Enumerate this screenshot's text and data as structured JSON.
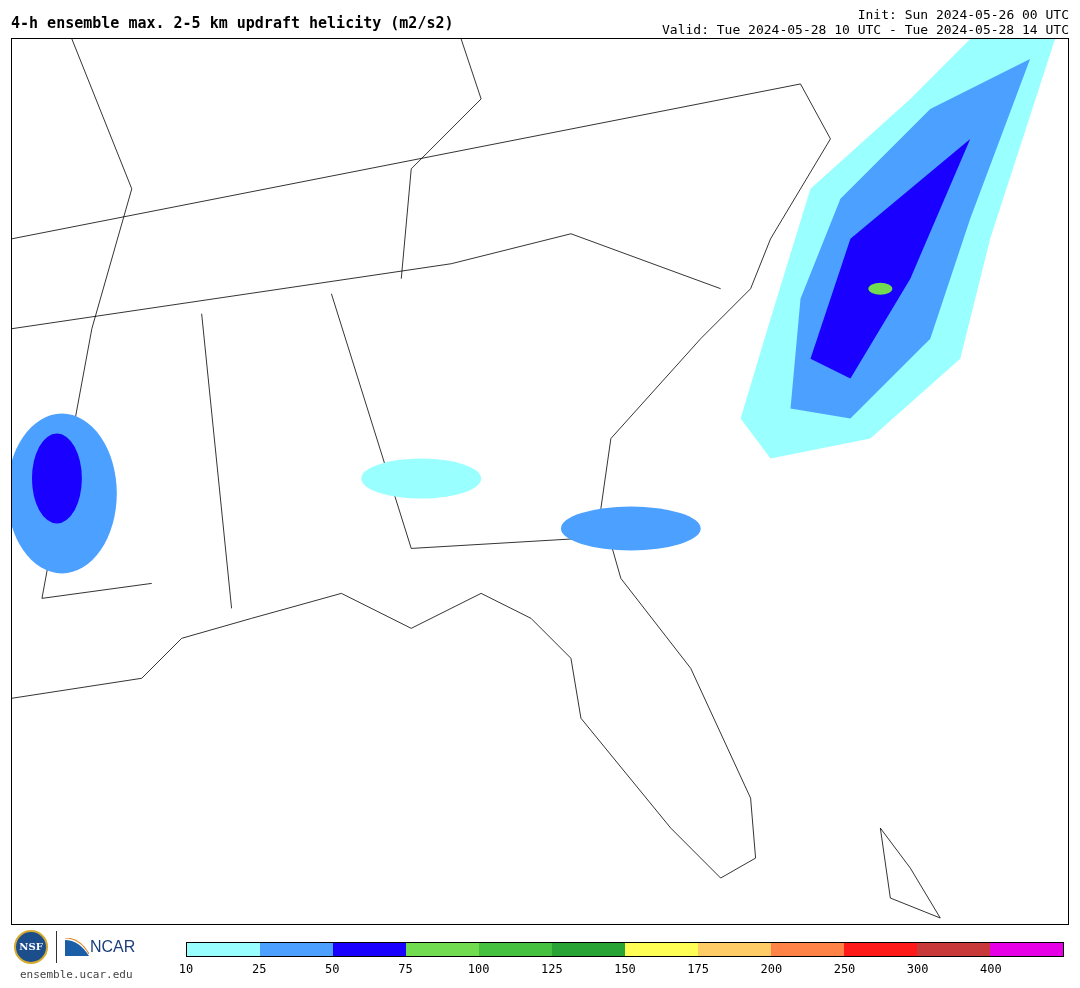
{
  "title": "4-h ensemble max. 2-5 km updraft helicity (m2/s2)",
  "init": "Init: Sun 2024-05-26 00 UTC",
  "valid": "Valid: Tue 2024-05-28 10 UTC - Tue 2024-05-28 14 UTC",
  "logos": {
    "nsf": "NSF",
    "ncar": "NCAR",
    "url": "ensemble.ucar.edu"
  },
  "colorbar": {
    "bins": [
      {
        "color": "#99ffff"
      },
      {
        "color": "#4ca0ff"
      },
      {
        "color": "#1a00ff"
      },
      {
        "color": "#72dc50"
      },
      {
        "color": "#45c13f"
      },
      {
        "color": "#27a435"
      },
      {
        "color": "#ffff55"
      },
      {
        "color": "#ffcc66"
      },
      {
        "color": "#ff8247"
      },
      {
        "color": "#ff1a1a"
      },
      {
        "color": "#c83a3a"
      },
      {
        "color": "#e600e6"
      }
    ],
    "ticks": [
      "10",
      "25",
      "50",
      "75",
      "100",
      "125",
      "150",
      "175",
      "200",
      "250",
      "300",
      "400"
    ]
  }
}
